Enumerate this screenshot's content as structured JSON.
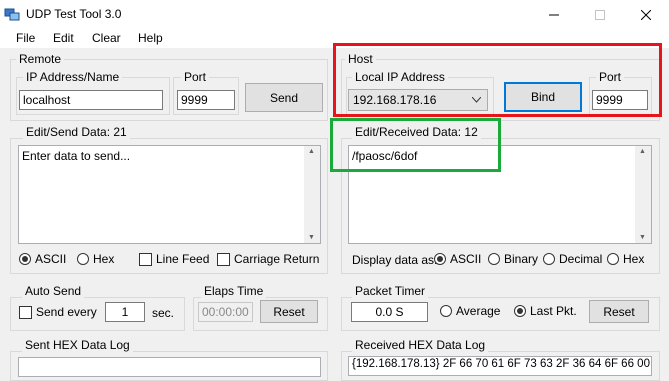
{
  "window": {
    "title": "UDP Test Tool 3.0"
  },
  "menu": {
    "file": "File",
    "edit": "Edit",
    "clear": "Clear",
    "help": "Help"
  },
  "remote": {
    "title": "Remote",
    "ip_label": "IP Address/Name",
    "ip_value": "localhost",
    "port_label": "Port",
    "port_value": "9999",
    "send_button": "Send"
  },
  "host": {
    "title": "Host",
    "local_ip_label": "Local IP Address",
    "local_ip_value": "192.168.178.16",
    "bind_button": "Bind",
    "port_label": "Port",
    "port_value": "9999"
  },
  "send_data": {
    "title": "Edit/Send Data: 21",
    "text": "Enter data to send...",
    "opt_ascii": "ASCII",
    "opt_hex": "Hex",
    "opt_linefeed": "Line Feed",
    "opt_cr": "Carriage Return"
  },
  "recv_data": {
    "title": "Edit/Received Data: 12",
    "text": "/fpaosc/6dof",
    "display_label": "Display data as:",
    "opt_ascii": "ASCII",
    "opt_binary": "Binary",
    "opt_decimal": "Decimal",
    "opt_hex": "Hex"
  },
  "auto_send": {
    "title": "Auto Send",
    "send_every": "Send every",
    "interval": "1",
    "unit": "sec."
  },
  "elaps": {
    "title": "Elaps Time",
    "value": "00:00:00",
    "reset": "Reset"
  },
  "packet_timer": {
    "title": "Packet Timer",
    "value": "0.0 S",
    "opt_average": "Average",
    "opt_last": "Last Pkt.",
    "reset": "Reset"
  },
  "sent_hex": {
    "title": "Sent HEX Data Log"
  },
  "recv_hex": {
    "title": "Received HEX Data Log",
    "line": "{192.168.178.13} 2F 66 70 61 6F 73 63 2F 36 64 6F 66 00"
  },
  "colors": {
    "red_highlight": "#e8141b",
    "green_highlight": "#1aaa3a",
    "focus_blue": "#0078d7"
  }
}
